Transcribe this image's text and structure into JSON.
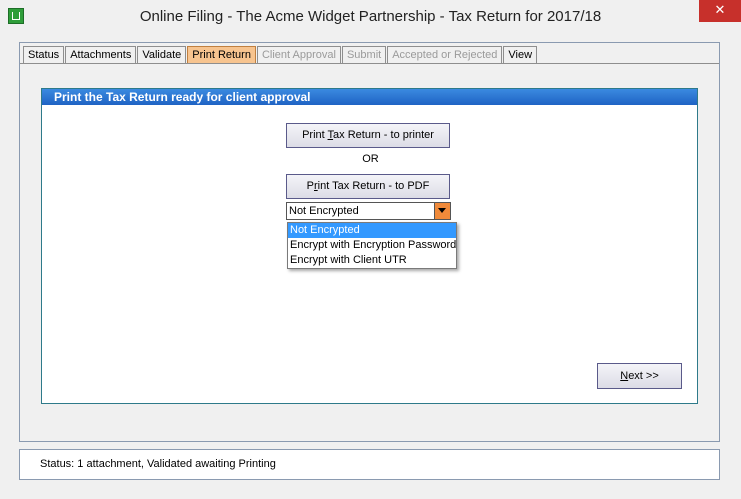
{
  "window": {
    "title": "Online Filing - The Acme Widget Partnership - Tax Return for 2017/18",
    "close_glyph": "✕"
  },
  "tabs": [
    {
      "label": "Status",
      "state": "normal"
    },
    {
      "label": "Attachments",
      "state": "normal"
    },
    {
      "label": "Validate",
      "state": "normal"
    },
    {
      "label": "Print Return",
      "state": "active"
    },
    {
      "label": "Client Approval",
      "state": "disabled"
    },
    {
      "label": "Submit",
      "state": "disabled"
    },
    {
      "label": "Accepted or Rejected",
      "state": "disabled"
    },
    {
      "label": "View",
      "state": "normal"
    }
  ],
  "panel": {
    "header": "Print the Tax Return ready for client approval",
    "print_printer": {
      "before": "Print ",
      "mnemonic": "T",
      "after": "ax Return - to printer"
    },
    "or_label": "OR",
    "print_pdf": {
      "before": "P",
      "mnemonic": "r",
      "after": "int Tax Return - to PDF"
    },
    "encryption": {
      "selected": "Not Encrypted",
      "options": [
        "Not Encrypted",
        "Encrypt with Encryption Password",
        "Encrypt with Client UTR"
      ],
      "highlighted_index": 0
    },
    "next": {
      "mnemonic": "N",
      "after": "ext >>"
    }
  },
  "status_bar": {
    "text": "Status: 1 attachment, Validated awaiting Printing"
  },
  "colors": {
    "active_tab": "#f7c48f",
    "header_blue": "#1f63c4",
    "close_red": "#c7302b",
    "dropdown_arrow": "#f08a3a",
    "selected_option": "#3399ff"
  }
}
